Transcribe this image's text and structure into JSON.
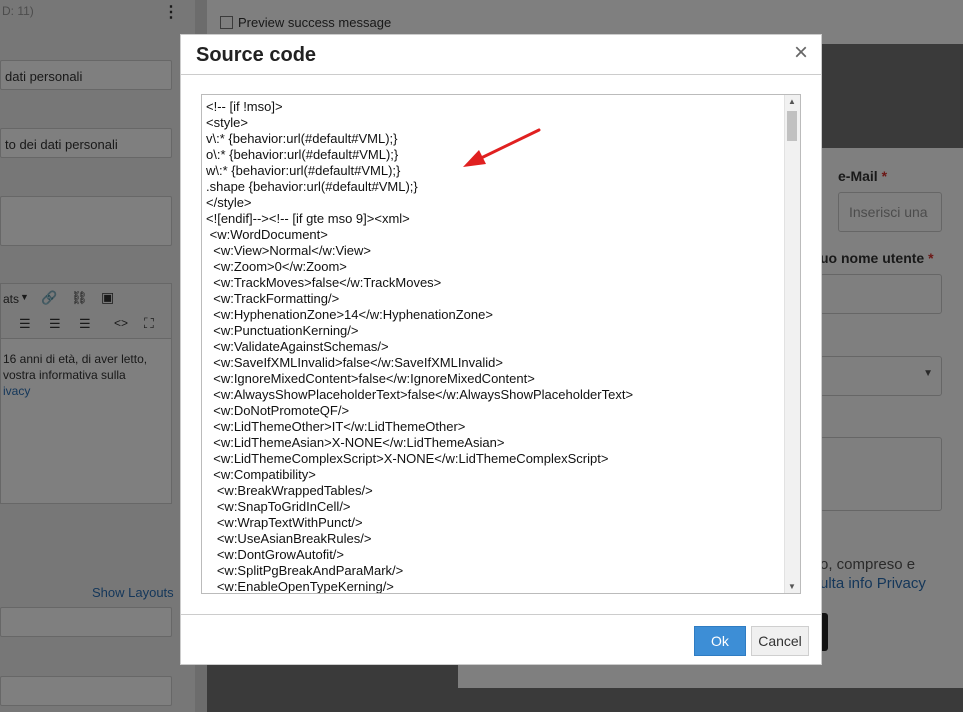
{
  "background": {
    "left_header_fragment": "D: 11)",
    "left_field_1": "dati personali",
    "left_field_2": "to dei dati personali",
    "toolbar_formats_fragment": "ats",
    "consent_text_lines": [
      "16 anni di età, di aver letto,",
      "vostra informativa sulla",
      "ivacy"
    ],
    "show_layouts_link": "Show Layouts",
    "preview_checkbox_label": "Preview success message",
    "email_label": "e-Mail",
    "email_placeholder": "Inserisci una",
    "username_label_fragment": "uo nome utente",
    "required_mark": "*",
    "consent_right_line1": "o, compreso e",
    "consent_right_line2": "ulta info Privacy"
  },
  "modal": {
    "title": "Source code",
    "close_symbol": "×",
    "code_lines": [
      "<!-- [if !mso]>",
      "<style>",
      "v\\:* {behavior:url(#default#VML);}",
      "o\\:* {behavior:url(#default#VML);}",
      "w\\:* {behavior:url(#default#VML);}",
      ".shape {behavior:url(#default#VML);}",
      "</style>",
      "<![endif]--><!-- [if gte mso 9]><xml>",
      " <w:WordDocument>",
      "  <w:View>Normal</w:View>",
      "  <w:Zoom>0</w:Zoom>",
      "  <w:TrackMoves>false</w:TrackMoves>",
      "  <w:TrackFormatting/>",
      "  <w:HyphenationZone>14</w:HyphenationZone>",
      "  <w:PunctuationKerning/>",
      "  <w:ValidateAgainstSchemas/>",
      "  <w:SaveIfXMLInvalid>false</w:SaveIfXMLInvalid>",
      "  <w:IgnoreMixedContent>false</w:IgnoreMixedContent>",
      "  <w:AlwaysShowPlaceholderText>false</w:AlwaysShowPlaceholderText>",
      "  <w:DoNotPromoteQF/>",
      "  <w:LidThemeOther>IT</w:LidThemeOther>",
      "  <w:LidThemeAsian>X-NONE</w:LidThemeAsian>",
      "  <w:LidThemeComplexScript>X-NONE</w:LidThemeComplexScript>",
      "  <w:Compatibility>",
      "   <w:BreakWrappedTables/>",
      "   <w:SnapToGridInCell/>",
      "   <w:WrapTextWithPunct/>",
      "   <w:UseAsianBreakRules/>",
      "   <w:DontGrowAutofit/>",
      "   <w:SplitPgBreakAndParaMark/>",
      "   <w:EnableOpenTypeKerning/>"
    ],
    "ok_label": "Ok",
    "cancel_label": "Cancel"
  },
  "icons": {
    "close": "close-icon",
    "arrow_annotation": "red-arrow-icon"
  },
  "colors": {
    "ok_button": "#3d8ed6",
    "link": "#2a6fb5",
    "required": "#d9302c",
    "arrow": "#e02020"
  }
}
